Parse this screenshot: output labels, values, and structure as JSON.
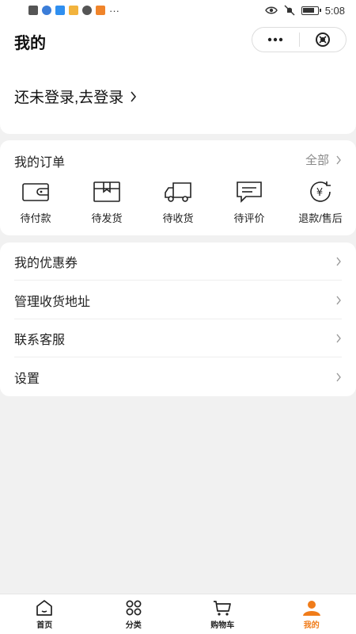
{
  "status_bar": {
    "time": "5:08",
    "more": "···",
    "left_icon_colors": [
      "#555555",
      "#3b7dd8",
      "#2f8ff0",
      "#f2b33d",
      "#555555",
      "#f0842a"
    ]
  },
  "header": {
    "title": "我的"
  },
  "login": {
    "text": "还未登录,去登录"
  },
  "orders": {
    "title": "我的订单",
    "all_label": "全部",
    "items": [
      {
        "label": "待付款",
        "icon": "wallet-icon"
      },
      {
        "label": "待发货",
        "icon": "package-icon"
      },
      {
        "label": "待收货",
        "icon": "truck-icon"
      },
      {
        "label": "待评价",
        "icon": "comment-icon"
      },
      {
        "label": "退款/售后",
        "icon": "refund-icon"
      }
    ]
  },
  "menu": {
    "items": [
      {
        "label": "我的优惠券"
      },
      {
        "label": "管理收货地址"
      },
      {
        "label": "联系客服"
      },
      {
        "label": "设置"
      }
    ]
  },
  "tabbar": {
    "tabs": [
      {
        "label": "首页",
        "icon": "home-icon"
      },
      {
        "label": "分类",
        "icon": "category-icon"
      },
      {
        "label": "购物车",
        "icon": "cart-icon"
      },
      {
        "label": "我的",
        "icon": "user-icon",
        "active": true
      }
    ],
    "active_color": "#f07c1a"
  }
}
